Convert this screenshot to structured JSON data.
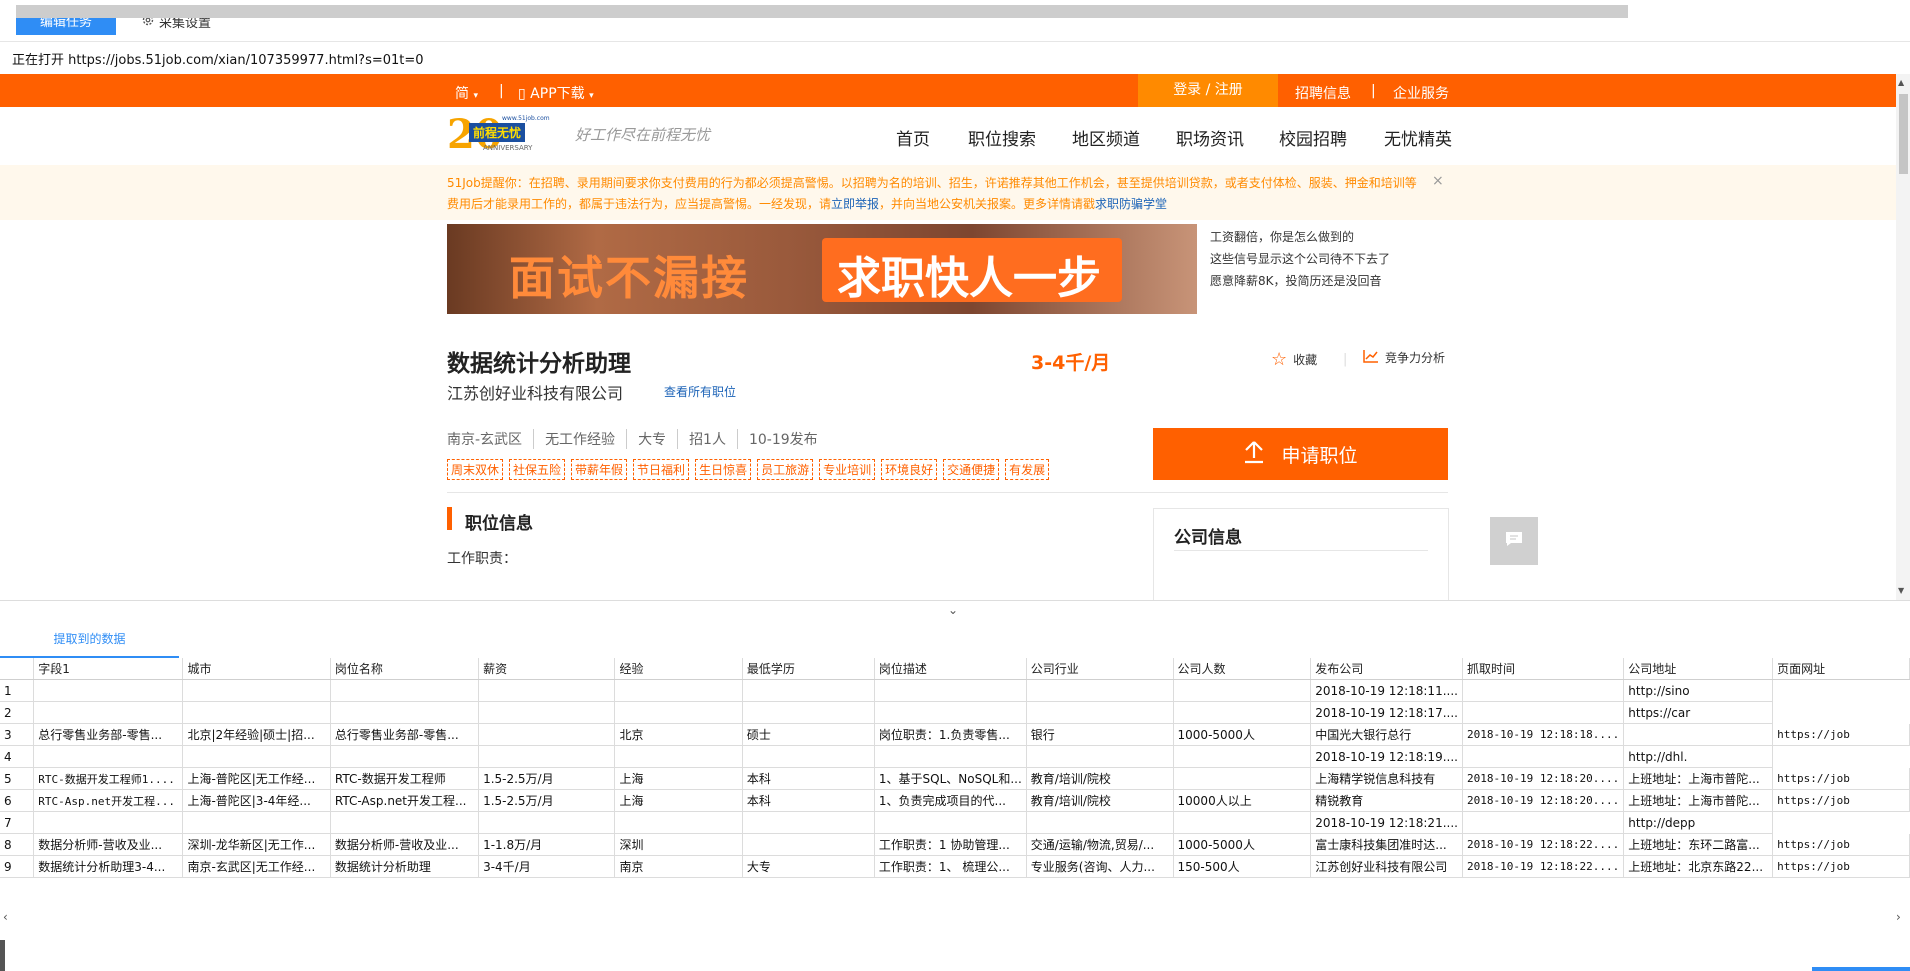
{
  "toolbar": {
    "edit_task": "编辑任务",
    "collect_settings": "采集设置"
  },
  "open_prefix": "正在打开",
  "open_url": "https://jobs.51job.com/xian/107359977.html?s=01t=0",
  "site": {
    "topbar": {
      "lang": "简",
      "app_download": "APP下载",
      "login": "登录 / 注册",
      "recruit_info": "招聘信息",
      "divider": "|",
      "enterprise": "企业服务"
    },
    "logo": {
      "text": "前程无忧",
      "url_small": "www.51job.com",
      "anniversary": "ANNIVERSARY",
      "slogan": "好工作尽在前程无忧"
    },
    "nav": [
      "首页",
      "职位搜索",
      "地区频道",
      "职场资讯",
      "校园招聘",
      "无忧精英"
    ],
    "notice": {
      "line1": "51Job提醒你：在招聘、录用期间要求你支付费用的行为都必须提高警惕。以招聘为名的培训、招生，许诺推荐其他工作机会，甚至提供培训贷款，或者支付体检、服装、押金和培训等",
      "line2_prefix": "费用后才能录用工作的，都属于违法行为，应当提高警惕。一经发现，请",
      "report": "立即举报",
      "line2_mid": "，并向当地公安机关报案。更多详情请戳",
      "fraud": "求职防骗学堂"
    },
    "banner": {
      "left": "面试不漏接",
      "right": "求职快人一步"
    },
    "ads": [
      "工资翻倍，你是怎么做到的",
      "这些信号显示这个公司待不下去了",
      "愿意降薪8K，投简历还是没回音"
    ],
    "job": {
      "title": "数据统计分析助理",
      "salary": "3-4千/月",
      "company": "江苏创好业科技有限公司",
      "all_jobs": "查看所有职位",
      "favorite": "收藏",
      "compete": "竞争力分析",
      "meta": [
        "南京-玄武区",
        "无工作经验",
        "大专",
        "招1人",
        "10-19发布"
      ],
      "tags": [
        "周末双休",
        "社保五险",
        "带薪年假",
        "节日福利",
        "生日惊喜",
        "员工旅游",
        "专业培训",
        "环境良好",
        "交通便捷",
        "有发展"
      ],
      "apply": "申请职位",
      "section": "职位信息",
      "duty": "工作职责：",
      "company_info": "公司信息"
    }
  },
  "tab": "提取到的数据",
  "table": {
    "columns": [
      "字段1",
      "城市",
      "岗位名称",
      "薪资",
      "经验",
      "最低学历",
      "岗位描述",
      "公司行业",
      "公司人数",
      "发布公司",
      "抓取时间",
      "公司地址",
      "页面网址"
    ],
    "rows": [
      [
        "1",
        "",
        "",
        "",
        "",
        "",
        "",
        "",
        "",
        "",
        "2018-10-19 12:18:11....",
        "",
        "http://sino"
      ],
      [
        "2",
        "",
        "",
        "",
        "",
        "",
        "",
        "",
        "",
        "",
        "2018-10-19 12:18:17....",
        "",
        "https://car"
      ],
      [
        "3",
        "总行零售业务部-零售...",
        "北京|2年经验|硕士|招...",
        "总行零售业务部-零售...",
        "",
        "北京",
        "硕士",
        "岗位职责：1.负责零售...",
        "银行",
        "1000-5000人",
        "中国光大银行总行",
        "2018-10-19 12:18:18....",
        "",
        "https://job"
      ],
      [
        "4",
        "",
        "",
        "",
        "",
        "",
        "",
        "",
        "",
        "",
        "2018-10-19 12:18:19....",
        "",
        "http://dhl."
      ],
      [
        "5",
        "RTC-数据开发工程师1....",
        "上海-普陀区|无工作经...",
        "RTC-数据开发工程师",
        "1.5-2.5万/月",
        "上海",
        "本科",
        "1、基于SQL、NoSQL和...",
        "教育/培训/院校",
        "",
        "上海精学锐信息科技有",
        "2018-10-19 12:18:20....",
        "上班地址：上海市普陀...",
        "https://job"
      ],
      [
        "6",
        "RTC-Asp.net开发工程...",
        "上海-普陀区|3-4年经...",
        "RTC-Asp.net开发工程...",
        "1.5-2.5万/月",
        "上海",
        "本科",
        "1、负责完成项目的代...",
        "教育/培训/院校",
        "10000人以上",
        "精锐教育",
        "2018-10-19 12:18:20....",
        "上班地址：上海市普陀...",
        "https://job"
      ],
      [
        "7",
        "",
        "",
        "",
        "",
        "",
        "",
        "",
        "",
        "",
        "2018-10-19 12:18:21....",
        "",
        "http://depp"
      ],
      [
        "8",
        "数据分析师-营收及业...",
        "深圳-龙华新区|无工作...",
        "数据分析师-营收及业...",
        "1-1.8万/月",
        "深圳",
        "",
        "工作职责：1 协助管理...",
        "交通/运输/物流,贸易/...",
        "1000-5000人",
        "富士康科技集团准时达...",
        "2018-10-19 12:18:22....",
        "上班地址：东环二路富...",
        "https://job"
      ],
      [
        "9",
        "数据统计分析助理3-4...",
        "南京-玄武区|无工作经...",
        "数据统计分析助理",
        "3-4千/月",
        "南京",
        "大专",
        "工作职责：1、 梳理公...",
        "专业服务(咨询、人力...",
        "150-500人",
        "江苏创好业科技有限公司",
        "2018-10-19 12:18:22....",
        "上班地址：北京东路22...",
        "https://job"
      ]
    ]
  },
  "colors": {
    "orange": "#ff6000",
    "blue": "#2f8df5",
    "login_bg": "#ff8a00"
  }
}
